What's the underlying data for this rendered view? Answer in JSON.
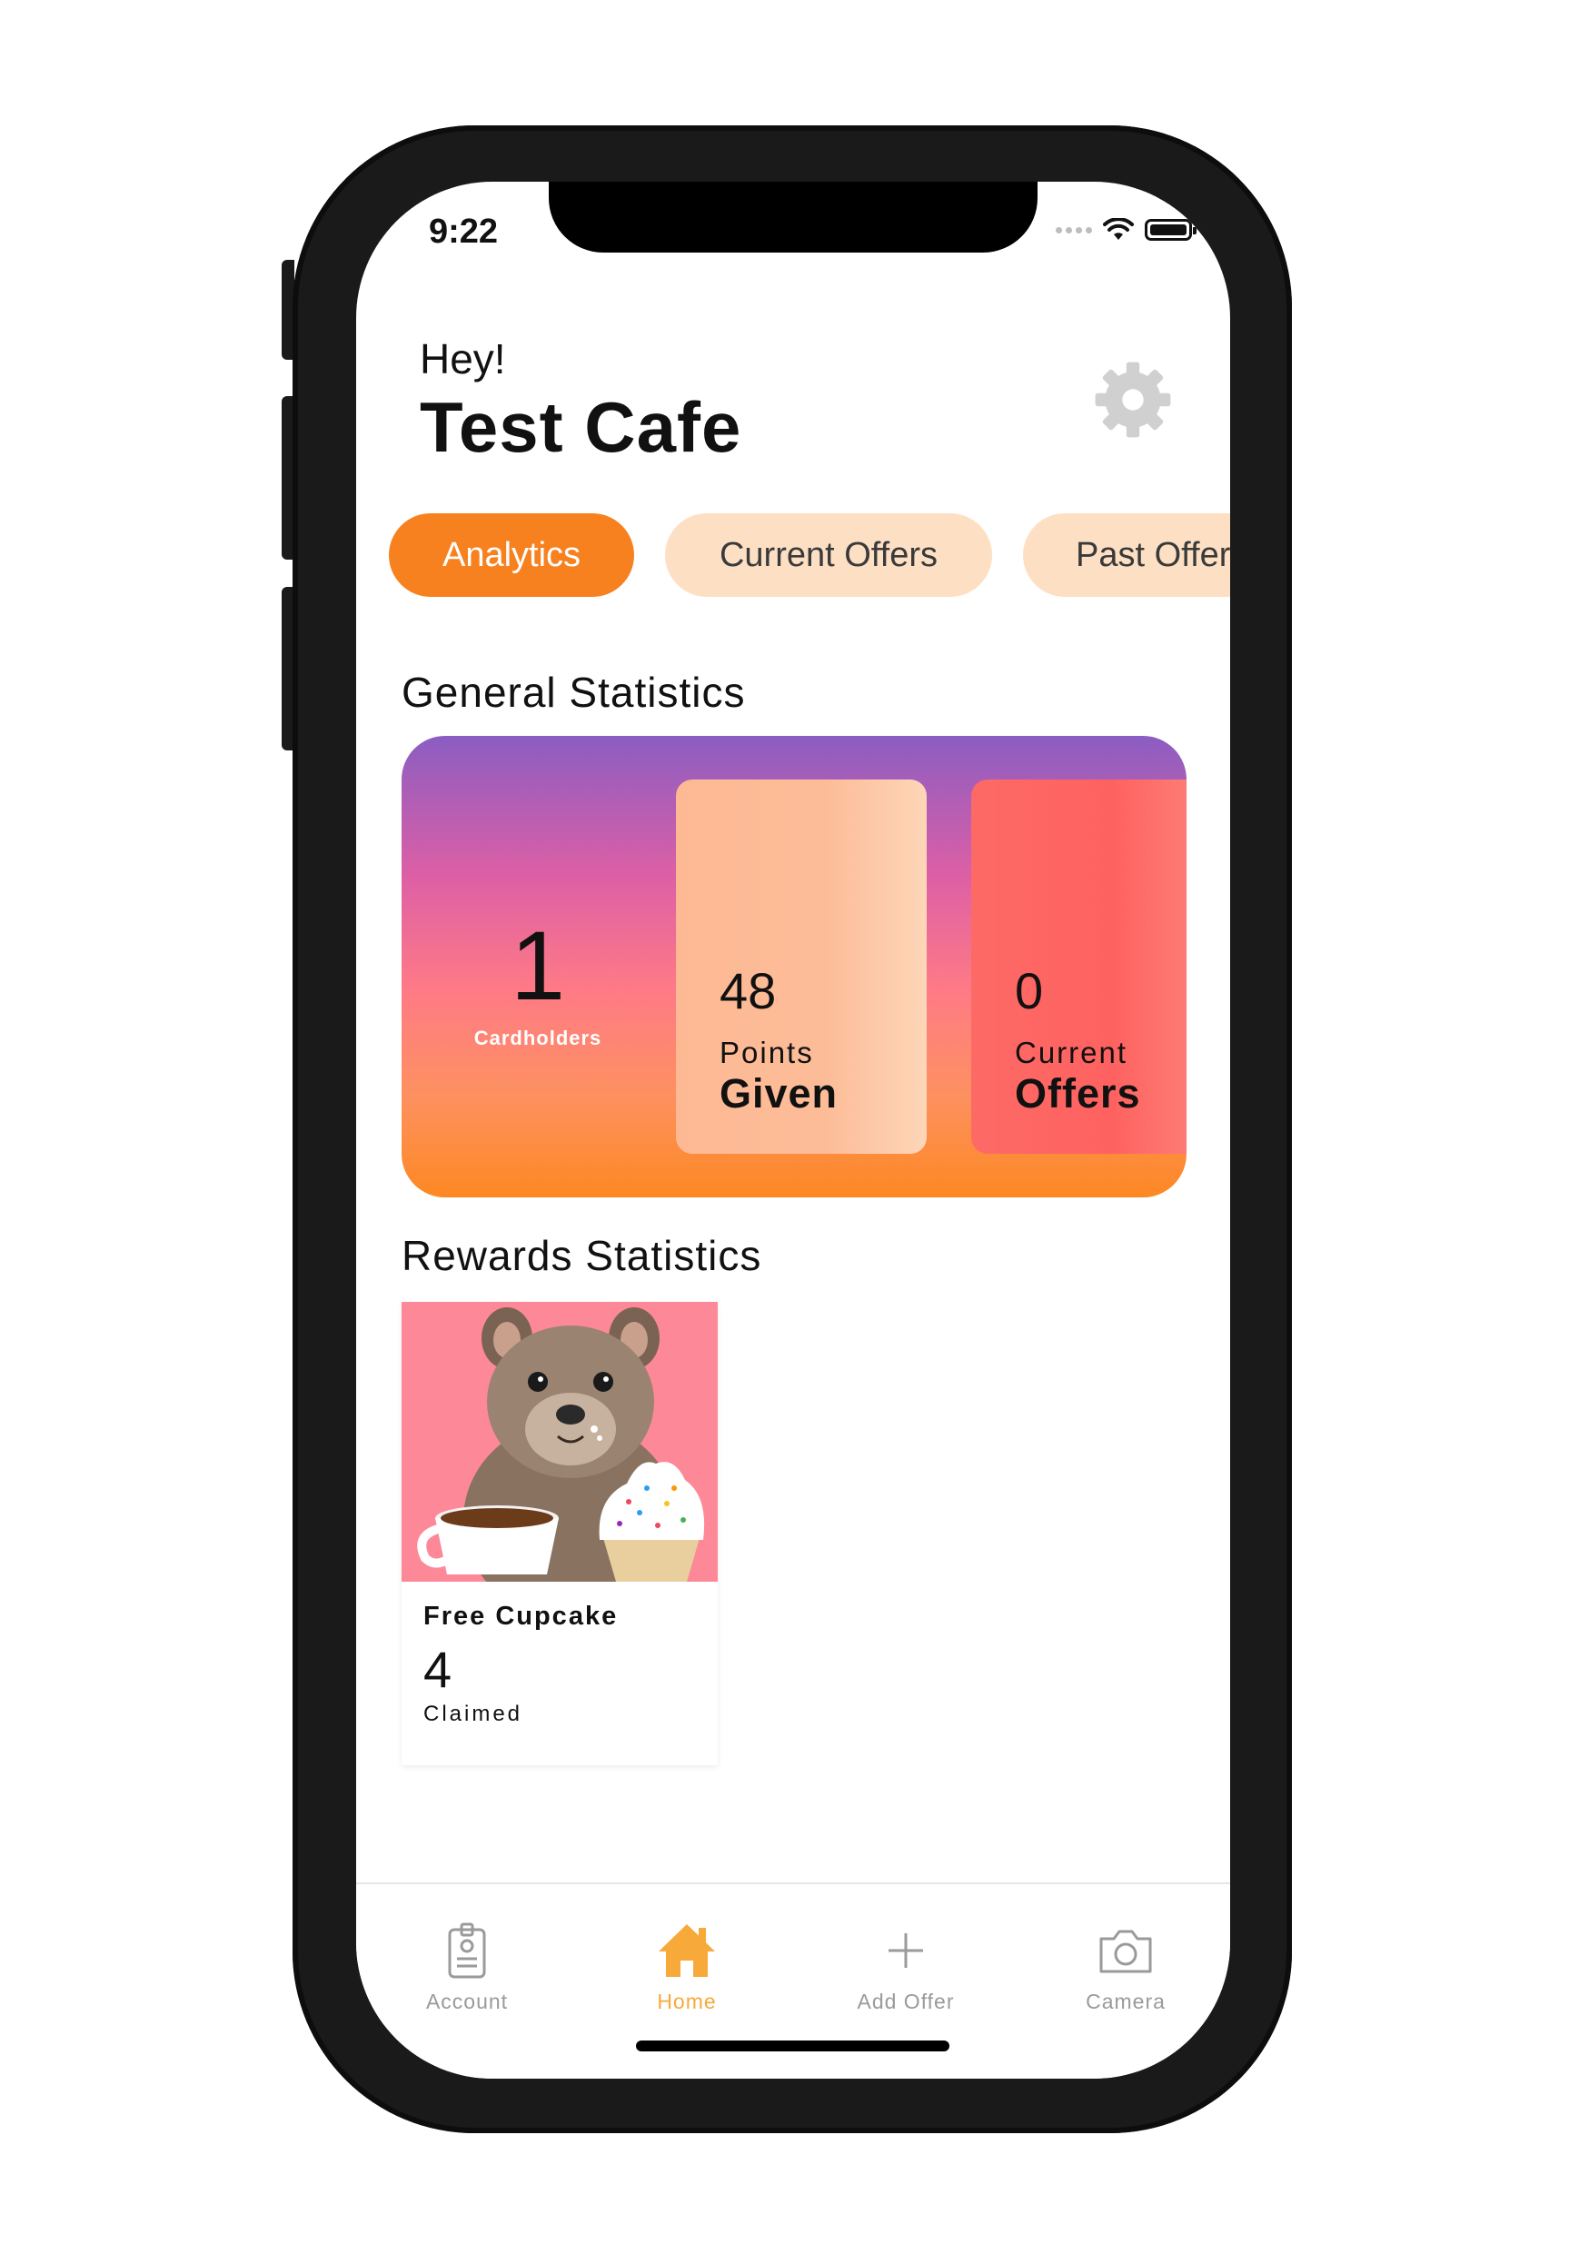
{
  "status_bar": {
    "time": "9:22"
  },
  "header": {
    "greeting": "Hey!",
    "cafe_name": "Test Cafe",
    "settings_icon": "gear-icon"
  },
  "tabs": [
    {
      "label": "Analytics",
      "active": true
    },
    {
      "label": "Current Offers",
      "active": false
    },
    {
      "label": "Past Offers",
      "active": false
    }
  ],
  "general_statistics": {
    "title": "General Statistics",
    "cardholders": {
      "value": "1",
      "label": "Cardholders"
    },
    "points": {
      "value": "48",
      "line1": "Points",
      "line2": "Given"
    },
    "offers": {
      "value": "0",
      "line1": "Current",
      "line2": "Offers"
    }
  },
  "rewards_statistics": {
    "title": "Rewards Statistics",
    "rewards": [
      {
        "name": "Free Cupcake",
        "count": "4",
        "label": "Claimed",
        "image": "quokka-coffee-cupcake"
      }
    ]
  },
  "bottom_nav": [
    {
      "label": "Account",
      "icon": "id-badge-icon",
      "active": false
    },
    {
      "label": "Home",
      "icon": "home-icon",
      "active": true
    },
    {
      "label": "Add Offer",
      "icon": "plus-icon",
      "active": false
    },
    {
      "label": "Camera",
      "icon": "camera-icon",
      "active": false
    }
  ],
  "colors": {
    "accent": "#f7811f",
    "tab_inactive": "#fde0c4",
    "nav_active": "#f7a93a",
    "nav_inactive": "#9a9a9a"
  }
}
